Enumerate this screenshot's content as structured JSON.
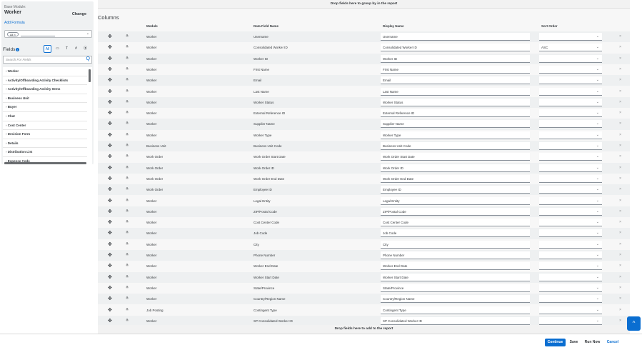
{
  "sidebar": {
    "base_module_label": "Base Module:",
    "base_module_value": "Worker",
    "change_label": "Change",
    "add_formula_label": "Add Formula",
    "filter_chip": "All",
    "filter_chip_close": "×",
    "filter_caret": "⌄",
    "fields_label": "Fields",
    "info_glyph": "i",
    "field_type_buttons": [
      {
        "label": "All",
        "icon": "all-icon"
      },
      {
        "label": "▭",
        "icon": "calendar-icon"
      },
      {
        "label": "T",
        "icon": "text-icon"
      },
      {
        "label": "#",
        "icon": "number-icon"
      },
      {
        "label": "⦿",
        "icon": "eye-icon"
      }
    ],
    "search_placeholder": "Search For Fields",
    "search_icon": "Q",
    "field_items": [
      "Worker",
      "Activity/Offboarding Activity Checklists",
      "Activity/Offboarding Activity Items",
      "Business Unit",
      "Buyer",
      "Chat",
      "Cost Center",
      "Decision Form",
      "Details",
      "Distribution List",
      "Expense Code"
    ],
    "chevron": "›"
  },
  "main": {
    "drop_group_text": "Drop fields here to group by in the report",
    "columns_title": "Columns",
    "headers": {
      "module": "Module",
      "data_field": "Data Field Name",
      "display": "Display Name",
      "sort": "Sort Order"
    },
    "drag_glyph": "✥",
    "expand_glyph": "≚",
    "caret_glyph": "⌄",
    "delete_glyph": "×",
    "rows": [
      {
        "module": "Worker",
        "field": "Username",
        "display": "Username",
        "sort": ""
      },
      {
        "module": "Worker",
        "field": "Consolidated Worker ID",
        "display": "Consolidated Worker ID",
        "sort": "ASC"
      },
      {
        "module": "Worker",
        "field": "Worker ID",
        "display": "Worker ID",
        "sort": ""
      },
      {
        "module": "Worker",
        "field": "First Name",
        "display": "First Name",
        "sort": ""
      },
      {
        "module": "Worker",
        "field": "Email",
        "display": "Email",
        "sort": ""
      },
      {
        "module": "Worker",
        "field": "Last Name",
        "display": "Last Name",
        "sort": ""
      },
      {
        "module": "Worker",
        "field": "Worker Status",
        "display": "Worker Status",
        "sort": ""
      },
      {
        "module": "Worker",
        "field": "External Reference ID",
        "display": "External Reference ID",
        "sort": ""
      },
      {
        "module": "Worker",
        "field": "Supplier Name",
        "display": "Supplier Name",
        "sort": ""
      },
      {
        "module": "Worker",
        "field": "Worker Type",
        "display": "Worker Type",
        "sort": ""
      },
      {
        "module": "Business Unit",
        "field": "Business Unit Code",
        "display": "Business Unit Code",
        "sort": ""
      },
      {
        "module": "Work Order",
        "field": "Work Order Start Date",
        "display": "Work Order Start Date",
        "sort": ""
      },
      {
        "module": "Work Order",
        "field": "Work Order ID",
        "display": "Work Order ID",
        "sort": ""
      },
      {
        "module": "Work Order",
        "field": "Work Order End Date",
        "display": "Work Order End Date",
        "sort": ""
      },
      {
        "module": "Work Order",
        "field": "Employee ID",
        "display": "Employee ID",
        "sort": ""
      },
      {
        "module": "Worker",
        "field": "Legal Entity",
        "display": "Legal Entity",
        "sort": ""
      },
      {
        "module": "Worker",
        "field": "ZIP/Postal Code",
        "display": "ZIP/Postal Code",
        "sort": ""
      },
      {
        "module": "Worker",
        "field": "Cost Center Code",
        "display": "Cost Center Code",
        "sort": ""
      },
      {
        "module": "Worker",
        "field": "Job Code",
        "display": "Job Code",
        "sort": ""
      },
      {
        "module": "Worker",
        "field": "City",
        "display": "City",
        "sort": ""
      },
      {
        "module": "Worker",
        "field": "Phone Number",
        "display": "Phone Number",
        "sort": ""
      },
      {
        "module": "Worker",
        "field": "Worker End Date",
        "display": "Worker End Date",
        "sort": ""
      },
      {
        "module": "Worker",
        "field": "Worker Start Date",
        "display": "Worker Start Date",
        "sort": ""
      },
      {
        "module": "Worker",
        "field": "State/Province",
        "display": "State/Province",
        "sort": ""
      },
      {
        "module": "Worker",
        "field": "Country/Region Name",
        "display": "Country/Region Name",
        "sort": ""
      },
      {
        "module": "Job Posting",
        "field": "Contingent Type",
        "display": "Contingent Type",
        "sort": ""
      },
      {
        "module": "Worker",
        "field": "SP Consolidated Worker ID",
        "display": "SP Consolidated Worker ID",
        "sort": ""
      }
    ],
    "drop_add_text": "Drop fields here to add to the report"
  },
  "footer": {
    "continue_label": "Continue",
    "save_label": "Save",
    "run_now_label": "Run Now",
    "cancel_label": "Cancel"
  },
  "scroll_top_glyph": "^",
  "colors": {
    "accent": "#0a6ed1",
    "row_alt": "#eef0f1",
    "panel": "#eff1f2"
  }
}
